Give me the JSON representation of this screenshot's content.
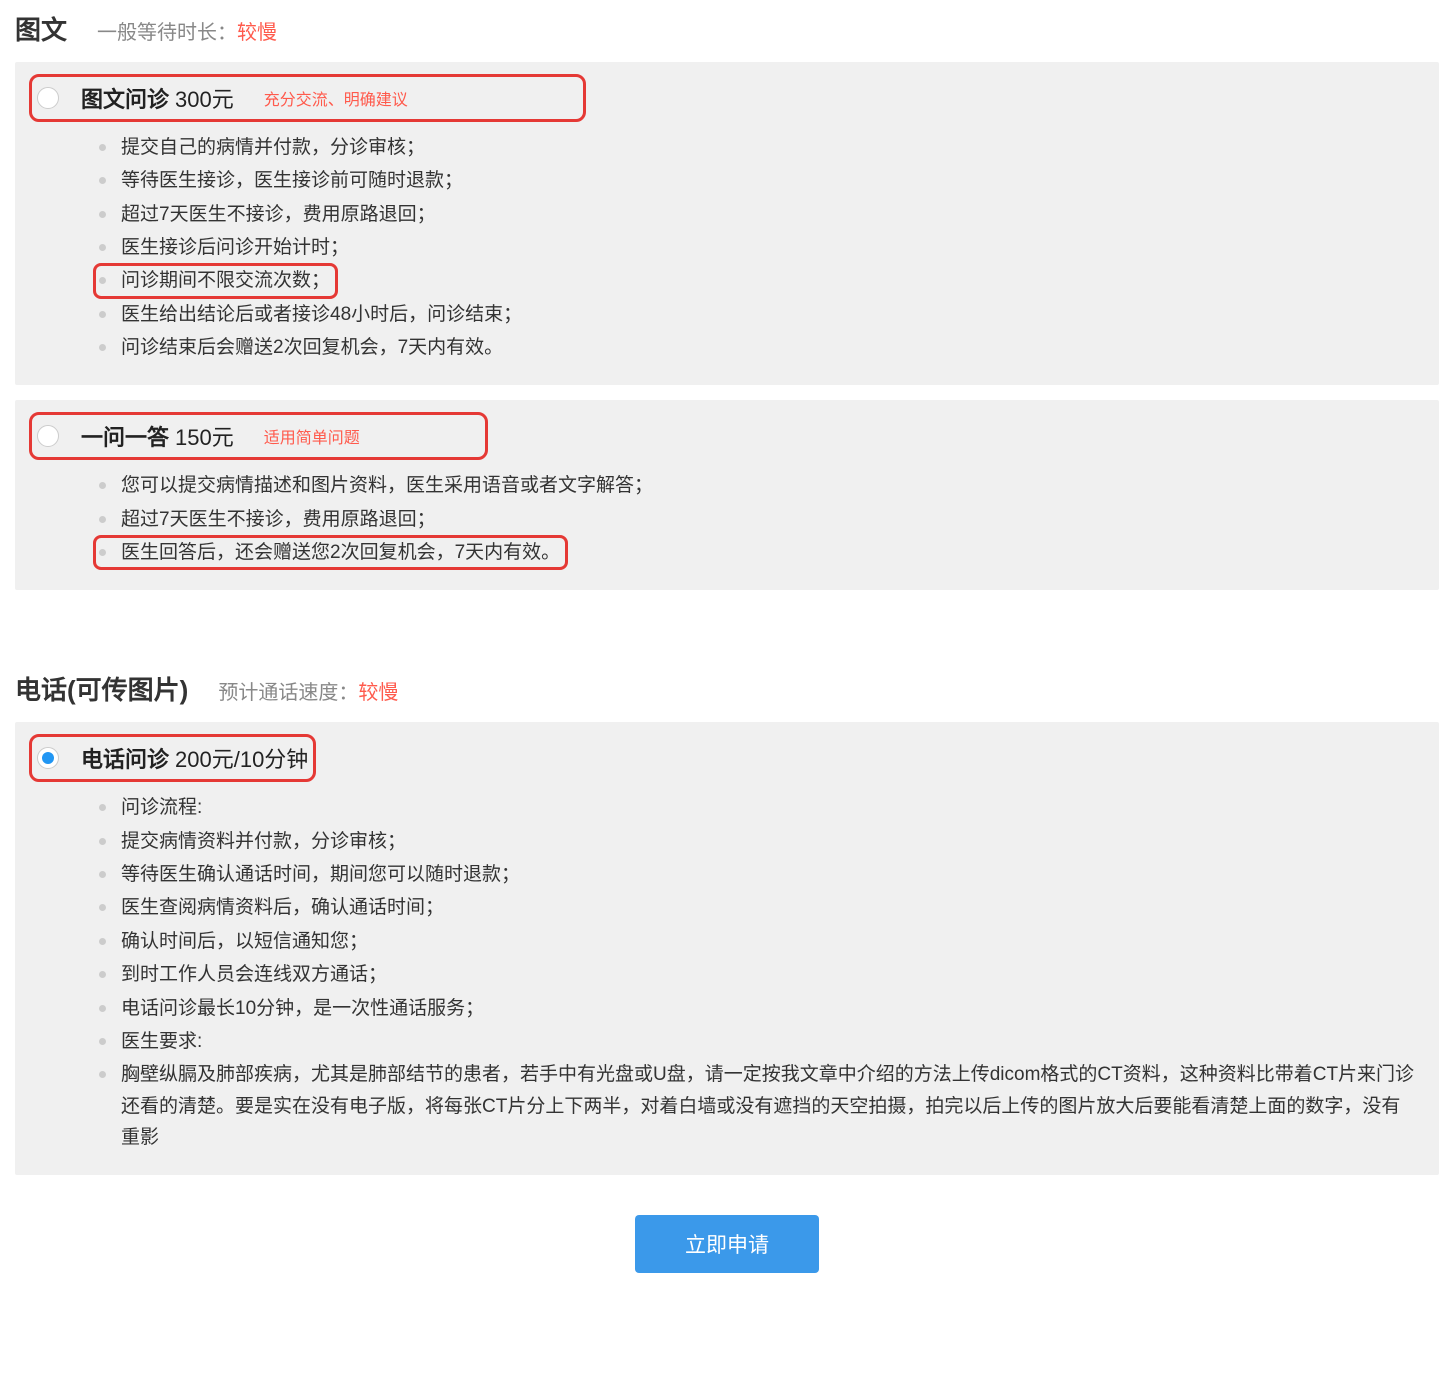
{
  "sections": [
    {
      "title": "图文",
      "subtitle_label": "一般等待时长：",
      "speed": "较慢",
      "options": [
        {
          "name": "图文问诊",
          "price": "300元",
          "tag": "充分交流、明确建议",
          "selected": false,
          "header_highlighted": true,
          "header_wide_class": "wide-header",
          "details": [
            {
              "text": "提交自己的病情并付款，分诊审核；",
              "highlighted": false
            },
            {
              "text": "等待医生接诊，医生接诊前可随时退款；",
              "highlighted": false
            },
            {
              "text": "超过7天医生不接诊，费用原路退回；",
              "highlighted": false
            },
            {
              "text": "医生接诊后问诊开始计时；",
              "highlighted": false
            },
            {
              "text": "问诊期间不限交流次数；",
              "highlighted": true
            },
            {
              "text": "医生给出结论后或者接诊48小时后，问诊结束；",
              "highlighted": false
            },
            {
              "text": "问诊结束后会赠送2次回复机会，7天内有效。",
              "highlighted": false
            }
          ]
        },
        {
          "name": "一问一答",
          "price": "150元",
          "tag": "适用简单问题",
          "selected": false,
          "header_highlighted": true,
          "header_wide_class": "wide-header2",
          "details": [
            {
              "text": "您可以提交病情描述和图片资料，医生采用语音或者文字解答；",
              "highlighted": false
            },
            {
              "text": "超过7天医生不接诊，费用原路退回；",
              "highlighted": false
            },
            {
              "text": "医生回答后，还会赠送您2次回复机会，7天内有效。",
              "highlighted": true
            }
          ]
        }
      ]
    },
    {
      "title": "电话(可传图片)",
      "subtitle_label": "预计通话速度：",
      "speed": "较慢",
      "options": [
        {
          "name": "电话问诊",
          "price": "200元/10分钟",
          "tag": "",
          "selected": true,
          "header_highlighted": true,
          "header_wide_class": "",
          "details": [
            {
              "text": "问诊流程:",
              "highlighted": false
            },
            {
              "text": "提交病情资料并付款，分诊审核；",
              "highlighted": false
            },
            {
              "text": "等待医生确认通话时间，期间您可以随时退款；",
              "highlighted": false
            },
            {
              "text": "医生查阅病情资料后，确认通话时间；",
              "highlighted": false
            },
            {
              "text": "确认时间后，以短信通知您；",
              "highlighted": false
            },
            {
              "text": "到时工作人员会连线双方通话；",
              "highlighted": false
            },
            {
              "text": "电话问诊最长10分钟，是一次性通话服务；",
              "highlighted": false
            },
            {
              "text": "医生要求:",
              "highlighted": false
            },
            {
              "text": "胸壁纵膈及肺部疾病，尤其是肺部结节的患者，若手中有光盘或U盘，请一定按我文章中介绍的方法上传dicom格式的CT资料，这种资料比带着CT片来门诊还看的清楚。要是实在没有电子版，将每张CT片分上下两半，对着白墙或没有遮挡的天空拍摄，拍完以后上传的图片放大后要能看清楚上面的数字，没有重影",
              "highlighted": false
            }
          ]
        }
      ]
    }
  ],
  "apply_button": "立即申请"
}
